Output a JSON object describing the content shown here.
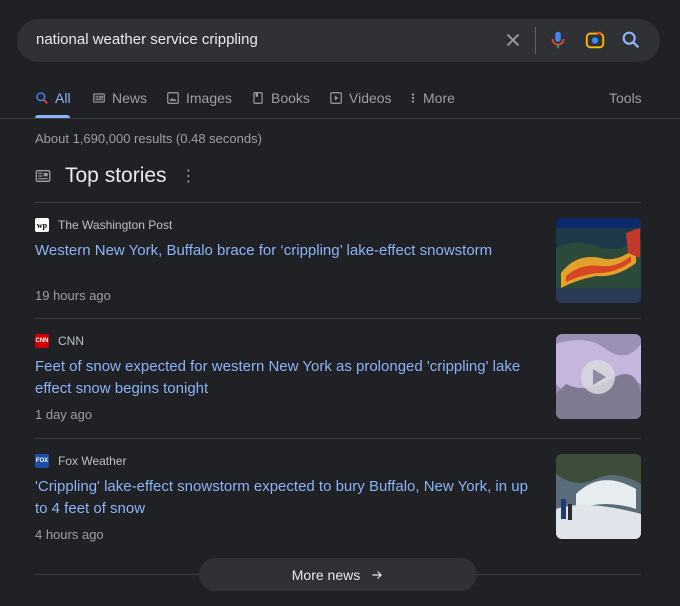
{
  "search": {
    "query": "national weather service crippling"
  },
  "tabs": [
    {
      "label": "All",
      "icon": "search-icon",
      "active": true
    },
    {
      "label": "News",
      "icon": "news-icon"
    },
    {
      "label": "Images",
      "icon": "image-icon"
    },
    {
      "label": "Books",
      "icon": "book-icon"
    },
    {
      "label": "Videos",
      "icon": "video-icon"
    },
    {
      "label": "More",
      "icon": "more-vert-icon"
    }
  ],
  "tools_label": "Tools",
  "result_stats": "About 1,690,000 results (0.48 seconds)",
  "top_stories": {
    "title": "Top stories",
    "stories": [
      {
        "source": "The Washington Post",
        "favicon_text": "wp",
        "headline": "Western New York, Buffalo brace for ‘crippling’ lake-effect snowstorm",
        "time": "19 hours ago"
      },
      {
        "source": "CNN",
        "favicon_text": "CNN",
        "favicon_color": "#cc0000",
        "headline": "Feet of snow expected for western New York as prolonged 'crippling' lake effect snow begins tonight",
        "time": "1 day ago"
      },
      {
        "source": "Fox Weather",
        "favicon_text": "FOX",
        "favicon_color": "#1a4fa3",
        "headline": "'Crippling' lake-effect snowstorm expected to bury Buffalo, New York, in up to 4 feet of snow",
        "time": "4 hours ago"
      }
    ]
  },
  "more_news_label": "More news",
  "colors": {
    "background": "#202124",
    "link": "#8ab4f8",
    "surface": "#303134"
  }
}
